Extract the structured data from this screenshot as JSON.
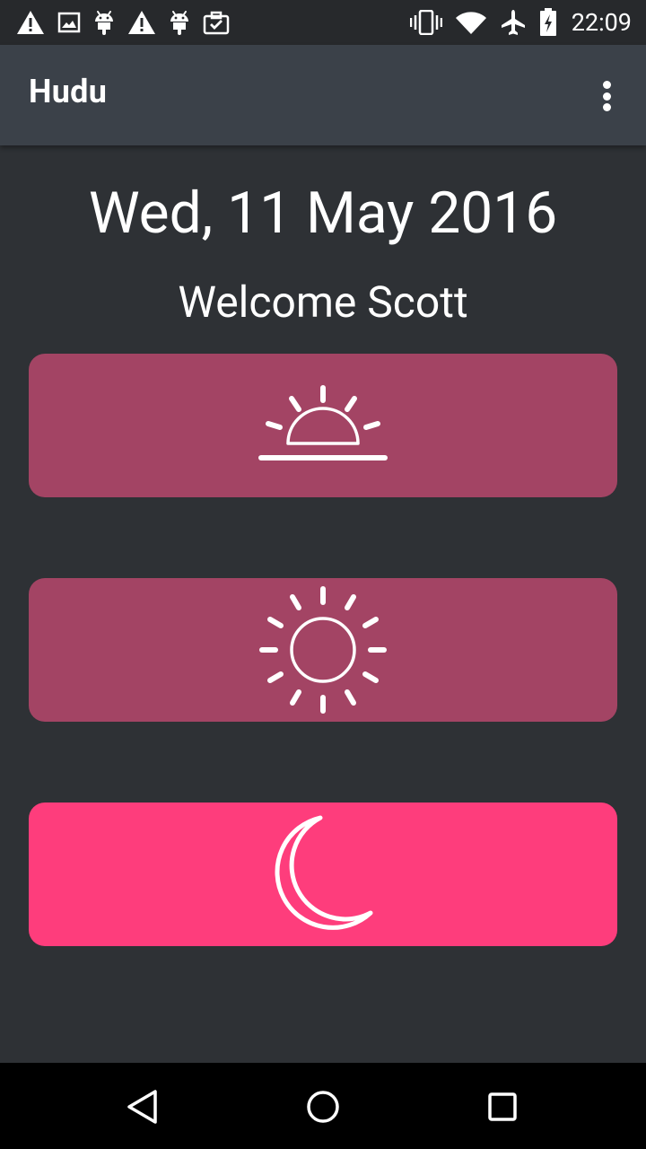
{
  "status_bar": {
    "time": "22:09",
    "left_icons": [
      "warning-icon",
      "image-icon",
      "android-icon",
      "warning-icon",
      "android-icon",
      "clipboard-check-icon"
    ],
    "right_icons": [
      "vibrate-icon",
      "wifi-icon",
      "airplane-icon",
      "battery-charging-icon"
    ]
  },
  "app_bar": {
    "title": "Hudu",
    "menu_icon": "more-vert-icon"
  },
  "main": {
    "date": "Wed, 11 May 2016",
    "welcome": "Welcome Scott",
    "tiles": [
      {
        "id": "morning",
        "icon": "sunrise-icon",
        "color": "#a34464"
      },
      {
        "id": "day",
        "icon": "sun-icon",
        "color": "#a34464"
      },
      {
        "id": "night",
        "icon": "moon-icon",
        "color": "#fe3d7c"
      }
    ]
  },
  "colors": {
    "background": "#2e3135",
    "app_bar": "#3b4149",
    "status_bar": "#27292c",
    "tile_muted": "#a34464",
    "tile_active": "#fe3d7c"
  },
  "nav_bar": {
    "buttons": [
      "back-icon",
      "home-icon",
      "recents-icon"
    ]
  }
}
